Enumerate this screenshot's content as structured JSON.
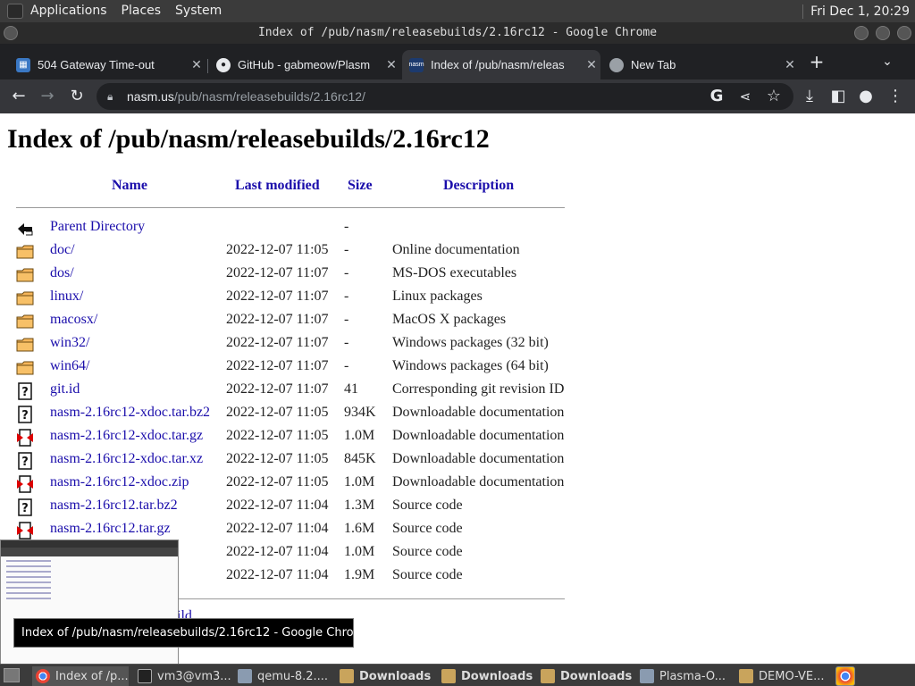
{
  "panel": {
    "menus": [
      "Applications",
      "Places",
      "System"
    ],
    "clock": "Fri Dec 1, 20:29"
  },
  "window": {
    "title": "Index of /pub/nasm/releasebuilds/2.16rc12 - Google Chrome"
  },
  "tabs": [
    {
      "label": "504 Gateway Time-out",
      "active": false
    },
    {
      "label": "GitHub - gabmeow/Plasm",
      "active": false
    },
    {
      "label": "Index of /pub/nasm/releas",
      "active": true
    },
    {
      "label": "New Tab",
      "active": false
    }
  ],
  "toolbar": {
    "url_host": "nasm.us",
    "url_path": "/pub/nasm/releasebuilds/2.16rc12/"
  },
  "page": {
    "heading": "Index of /pub/nasm/releasebuilds/2.16rc12",
    "columns": {
      "name": "Name",
      "modified": "Last modified",
      "size": "Size",
      "description": "Description"
    },
    "rows": [
      {
        "icon": "back",
        "name": "Parent Directory",
        "modified": "",
        "size": "-",
        "description": ""
      },
      {
        "icon": "folder",
        "name": "doc/",
        "modified": "2022-12-07 11:05",
        "size": "-",
        "description": "Online documentation"
      },
      {
        "icon": "folder",
        "name": "dos/",
        "modified": "2022-12-07 11:07",
        "size": "-",
        "description": "MS-DOS executables"
      },
      {
        "icon": "folder",
        "name": "linux/",
        "modified": "2022-12-07 11:07",
        "size": "-",
        "description": "Linux packages"
      },
      {
        "icon": "folder",
        "name": "macosx/",
        "modified": "2022-12-07 11:07",
        "size": "-",
        "description": "MacOS X packages"
      },
      {
        "icon": "folder",
        "name": "win32/",
        "modified": "2022-12-07 11:07",
        "size": "-",
        "description": "Windows packages (32 bit)"
      },
      {
        "icon": "folder",
        "name": "win64/",
        "modified": "2022-12-07 11:07",
        "size": "-",
        "description": "Windows packages (64 bit)"
      },
      {
        "icon": "unknown",
        "name": "git.id",
        "modified": "2022-12-07 11:07",
        "size": "41",
        "description": "Corresponding git revision ID"
      },
      {
        "icon": "unknown",
        "name": "nasm-2.16rc12-xdoc.tar.bz2",
        "modified": "2022-12-07 11:05",
        "size": "934K",
        "description": "Downloadable documentation"
      },
      {
        "icon": "compressed",
        "name": "nasm-2.16rc12-xdoc.tar.gz",
        "modified": "2022-12-07 11:05",
        "size": "1.0M",
        "description": "Downloadable documentation"
      },
      {
        "icon": "unknown",
        "name": "nasm-2.16rc12-xdoc.tar.xz",
        "modified": "2022-12-07 11:05",
        "size": "845K",
        "description": "Downloadable documentation"
      },
      {
        "icon": "compressed",
        "name": "nasm-2.16rc12-xdoc.zip",
        "modified": "2022-12-07 11:05",
        "size": "1.0M",
        "description": "Downloadable documentation"
      },
      {
        "icon": "unknown",
        "name": "nasm-2.16rc12.tar.bz2",
        "modified": "2022-12-07 11:04",
        "size": "1.3M",
        "description": "Source code"
      },
      {
        "icon": "compressed",
        "name": "nasm-2.16rc12.tar.gz",
        "modified": "2022-12-07 11:04",
        "size": "1.6M",
        "description": "Source code"
      },
      {
        "icon": "unknown",
        "name": "",
        "modified": "2022-12-07 11:04",
        "size": "1.0M",
        "description": "Source code"
      },
      {
        "icon": "unknown",
        "name": "",
        "modified": "2022-12-07 11:04",
        "size": "1.9M",
        "description": "Source code"
      }
    ],
    "partial_link": "uild"
  },
  "tooltip": "Index of /pub/nasm/releasebuilds/2.16rc12 - Google Chrome",
  "taskbar": [
    {
      "label": "Index of /p...",
      "icon": "chrome",
      "active": true,
      "bold": false
    },
    {
      "label": "vm3@vm3...",
      "icon": "terminal",
      "active": false,
      "bold": false
    },
    {
      "label": "qemu-8.2....",
      "icon": "package",
      "active": false,
      "bold": false
    },
    {
      "label": "Downloads",
      "icon": "folder",
      "active": false,
      "bold": true
    },
    {
      "label": "Downloads",
      "icon": "folder",
      "active": false,
      "bold": true
    },
    {
      "label": "Downloads",
      "icon": "folder",
      "active": false,
      "bold": true
    },
    {
      "label": "Plasma-O...",
      "icon": "package",
      "active": false,
      "bold": false
    },
    {
      "label": "DEMO-VE...",
      "icon": "folder",
      "active": false,
      "bold": false
    }
  ],
  "colors": {
    "link": "#1a0dab",
    "chrome_dark": "#35363a",
    "panel": "#3b3b3b"
  }
}
